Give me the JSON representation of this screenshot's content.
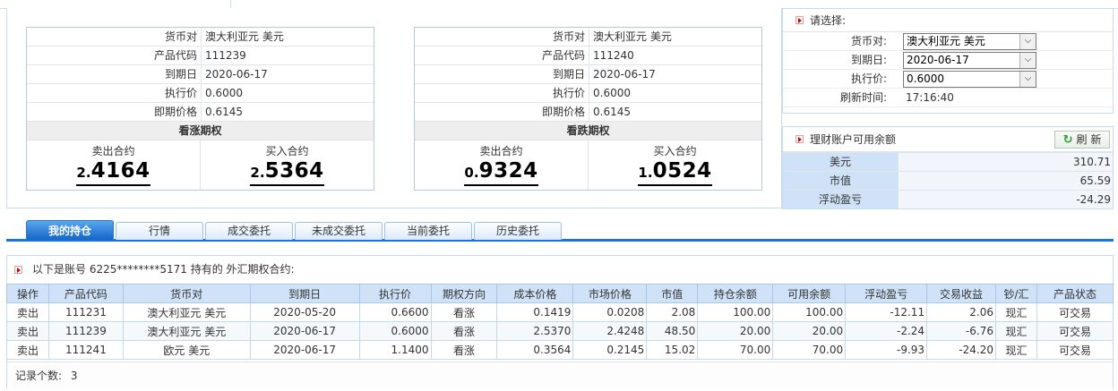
{
  "left_option": {
    "rows": [
      {
        "label": "货币对",
        "value": "澳大利亚元 美元"
      },
      {
        "label": "产品代码",
        "value": "111239"
      },
      {
        "label": "到期日",
        "value": "2020-06-17"
      },
      {
        "label": "执行价",
        "value": "0.6000"
      },
      {
        "label": "即期价格",
        "value": "0.6145"
      }
    ],
    "kind": "看涨期权",
    "sell_title": "卖出合约",
    "sell_small": "2.",
    "sell_big": "4164",
    "buy_title": "买入合约",
    "buy_small": "2.",
    "buy_big": "5364"
  },
  "right_option": {
    "rows": [
      {
        "label": "货币对",
        "value": "澳大利亚元 美元"
      },
      {
        "label": "产品代码",
        "value": "111240"
      },
      {
        "label": "到期日",
        "value": "2020-06-17"
      },
      {
        "label": "执行价",
        "value": "0.6000"
      },
      {
        "label": "即期价格",
        "value": "0.6145"
      }
    ],
    "kind": "看跌期权",
    "sell_title": "卖出合约",
    "sell_small": "0.",
    "sell_big": "9324",
    "buy_title": "买入合约",
    "buy_small": "1.",
    "buy_big": "0524"
  },
  "select_panel": {
    "title": "请选择:",
    "currency_label": "货币对:",
    "currency_value": "澳大利亚元 美元",
    "expiry_label": "到期日:",
    "expiry_value": "2020-06-17",
    "strike_label": "执行价:",
    "strike_value": "0.6000",
    "refresh_time_label": "刷新时间:",
    "refresh_time_value": "17:16:40",
    "dropdown_glyph": "⌵"
  },
  "balance_panel": {
    "title": "理财账户可用余额",
    "refresh_label": "刷 新",
    "refresh_icon": "↻",
    "rows": [
      {
        "label": "美元",
        "value": "310.71"
      },
      {
        "label": "市值",
        "value": "65.59"
      },
      {
        "label": "浮动盈亏",
        "value": "-24.29"
      }
    ]
  },
  "tabs": [
    "我的持仓",
    "行情",
    "成交委托",
    "未成交委托",
    "当前委托",
    "历史委托"
  ],
  "holdings": {
    "title": "以下是账号 6225********5171 持有的 外汇期权合约:",
    "columns": [
      "操作",
      "产品代码",
      "货币对",
      "到期日",
      "执行价",
      "期权方向",
      "成本价格",
      "市场价格",
      "市值",
      "持仓余额",
      "可用余额",
      "浮动盈亏",
      "交易收益",
      "钞/汇",
      "产品状态"
    ],
    "rows": [
      [
        "卖出",
        "111231",
        "澳大利亚元 美元",
        "2020-05-20",
        "0.6600",
        "看涨",
        "0.1419",
        "0.0208",
        "2.08",
        "100.00",
        "100.00",
        "-12.11",
        "2.06",
        "现汇",
        "可交易"
      ],
      [
        "卖出",
        "111239",
        "澳大利亚元 美元",
        "2020-06-17",
        "0.6000",
        "看涨",
        "2.5370",
        "2.4248",
        "48.50",
        "20.00",
        "20.00",
        "-2.24",
        "-6.76",
        "现汇",
        "可交易"
      ],
      [
        "卖出",
        "111241",
        "欧元 美元",
        "2020-06-17",
        "1.1400",
        "看涨",
        "0.3564",
        "0.2145",
        "15.02",
        "70.00",
        "70.00",
        "-9.93",
        "-24.20",
        "现汇",
        "可交易"
      ]
    ],
    "record_count_label": "记录个数:",
    "record_count": "3"
  }
}
